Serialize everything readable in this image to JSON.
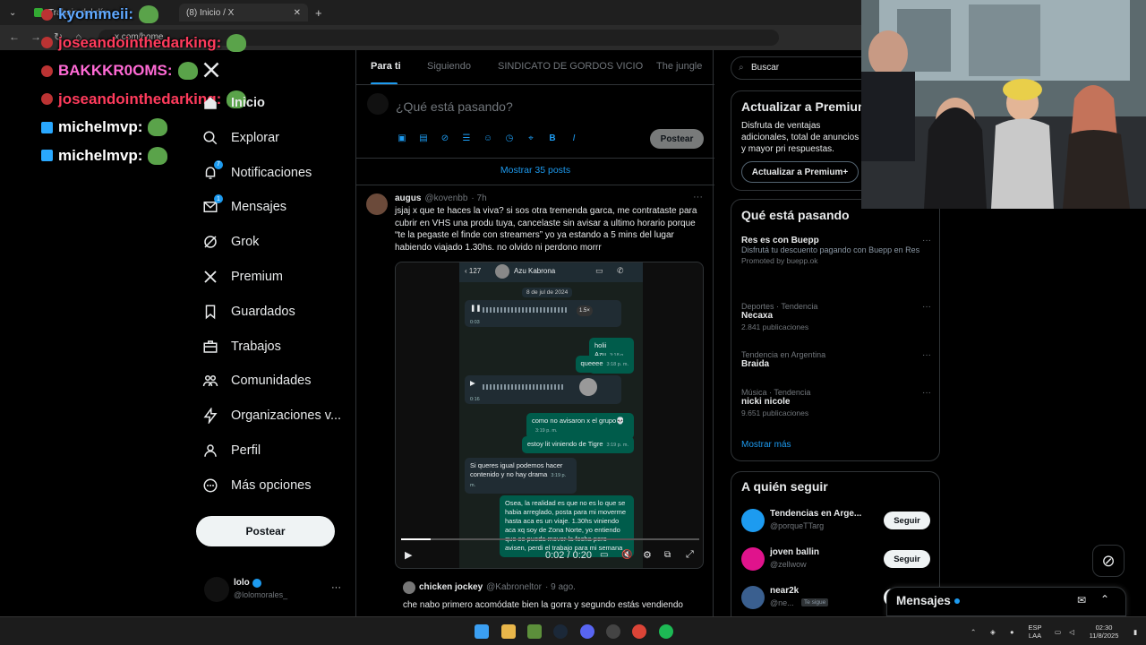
{
  "browser": {
    "tabs": [
      {
        "label": "Trabajo del día"
      },
      {
        "label": "(8) Inicio / X"
      }
    ],
    "url": "x.com/home",
    "new_tab_label": "+",
    "close_label": "✕"
  },
  "chat": [
    {
      "user": "kyommeii:",
      "color": "#5fa8ff"
    },
    {
      "user": "joseandointhedarking:",
      "color": "#ff3b5c"
    },
    {
      "user": "BAKKKR0OMS:",
      "color": "#ff6ad5"
    },
    {
      "user": "joseandointhedarking:",
      "color": "#ff3b5c"
    },
    {
      "user": "michelmvp:",
      "color": "#ffffff"
    },
    {
      "user": "michelmvp:",
      "color": "#ffffff"
    }
  ],
  "nav": {
    "items": [
      {
        "label": "Inicio",
        "icon": "home-icon"
      },
      {
        "label": "Explorar",
        "icon": "search-icon"
      },
      {
        "label": "Notificaciones",
        "icon": "bell-icon",
        "badge": "7"
      },
      {
        "label": "Mensajes",
        "icon": "mail-icon",
        "badge": "1"
      },
      {
        "label": "Grok",
        "icon": "grok-icon"
      },
      {
        "label": "Premium",
        "icon": "x-logo-icon"
      },
      {
        "label": "Guardados",
        "icon": "bookmark-icon"
      },
      {
        "label": "Trabajos",
        "icon": "briefcase-icon"
      },
      {
        "label": "Comunidades",
        "icon": "people-icon"
      },
      {
        "label": "Organizaciones v...",
        "icon": "lightning-icon"
      },
      {
        "label": "Perfil",
        "icon": "person-icon"
      },
      {
        "label": "Más opciones",
        "icon": "more-circle-icon"
      }
    ],
    "post_button": "Postear",
    "profile": {
      "name": "lolo",
      "handle": "@lolomorales_",
      "more": "···"
    }
  },
  "timeline": {
    "tabs": [
      "Para ti",
      "Siguiendo",
      "SINDICATO DE GORDOS VICIO",
      "The jungle"
    ],
    "compose_placeholder": "¿Qué está pasando?",
    "compose_post": "Postear",
    "show_posts": "Mostrar 35 posts",
    "tweet": {
      "name": "augus",
      "handle": "@kovenbb",
      "time": "· 7h",
      "more": "···",
      "text": "jsjaj x que te haces la viva? si sos otra tremenda garca, me contrataste para cubrir en VHS una produ tuya, cancelaste sin avisar a ultimo horario porque “te la pegaste el finde con streamers” yo ya estando a 5 mins del lugar habiendo viajado 1.30hs. no olvido ni perdono morrr"
    },
    "media": {
      "chat_name": "Azu Kabrona",
      "back_count": "127",
      "date": "8 de jul de 2024",
      "speed": "1.5×",
      "voice_time1": "0:03",
      "voice_time2": "0:16",
      "messages": [
        {
          "text": "holii Azu",
          "time": "3:18 p. m.",
          "dir": "out"
        },
        {
          "text": "queeee",
          "time": "3:18 p. m.",
          "dir": "out"
        },
        {
          "text": "como no avisaron x el grupo💀",
          "time": "3:19 p. m.",
          "dir": "out"
        },
        {
          "text": "estoy lit viniendo de Tigre",
          "time": "3:19 p. m.",
          "dir": "out"
        },
        {
          "text": "Si queres igual podemos hacer contenido y no hay drama",
          "time": "3:19 p. m.",
          "dir": "in"
        },
        {
          "text": "Osea, la realidad es que no es lo que se habia arreglado, posta para mi moverme hasta aca es un viaje. 1.30hs viniendo aca xq soy de Zona Norte, yo entiendo que se pueda mover la fecha pero avisen, perdi el trabajo para mi semana",
          "time": "",
          "dir": "out"
        }
      ],
      "video_time": "0:02 / 0:20",
      "progress": 0.1
    },
    "reply": {
      "name": "chicken jockey",
      "handle": "@Kabroneltor",
      "time": "· 9 ago.",
      "text": "che nabo primero acomódate bien la gorra y segundo estás vendiendo"
    }
  },
  "right": {
    "search_placeholder": "Buscar",
    "premium": {
      "title": "Actualizar a Premium",
      "body": "Disfruta de ventajas adicionales, total de anuncios y mayor pri respuestas.",
      "button": "Actualizar a Premium+"
    },
    "trends": {
      "title": "Qué está pasando",
      "items": [
        {
          "meta": "",
          "name": "Res es con Buepp",
          "desc": "Disfrutá tu descuento pagando con Buepp en Res",
          "count": "Promoted by buepp.ok"
        },
        {
          "meta": "Deportes · Tendencia",
          "name": "Necaxa",
          "desc": "",
          "count": "2.841 publicaciones"
        },
        {
          "meta": "Tendencia en Argentina",
          "name": "Braida",
          "desc": "",
          "count": ""
        },
        {
          "meta": "Música · Tendencia",
          "name": "nicki nicole",
          "desc": "",
          "count": "9.651 publicaciones"
        }
      ],
      "show_more": "Mostrar más"
    },
    "follow": {
      "title": "A quién seguir",
      "items": [
        {
          "name": "Tendencias en Arge...",
          "handle": "@porqueTTarg",
          "button": "Seguir",
          "color": "#1d9bf0"
        },
        {
          "name": "joven ballin",
          "handle": "@zellwow",
          "button": "Seguir",
          "color": "#e0138c"
        },
        {
          "name": "near2k",
          "handle": "@ne...",
          "button": "Seguir tú",
          "badge": "Te sigue",
          "color": "#3a5f8f"
        }
      ]
    }
  },
  "messages_drawer": {
    "title": "Mensajes"
  },
  "taskbar": {
    "lang": "ESP",
    "lang2": "LAA",
    "time": "02:30",
    "date": "11/8/2025"
  }
}
